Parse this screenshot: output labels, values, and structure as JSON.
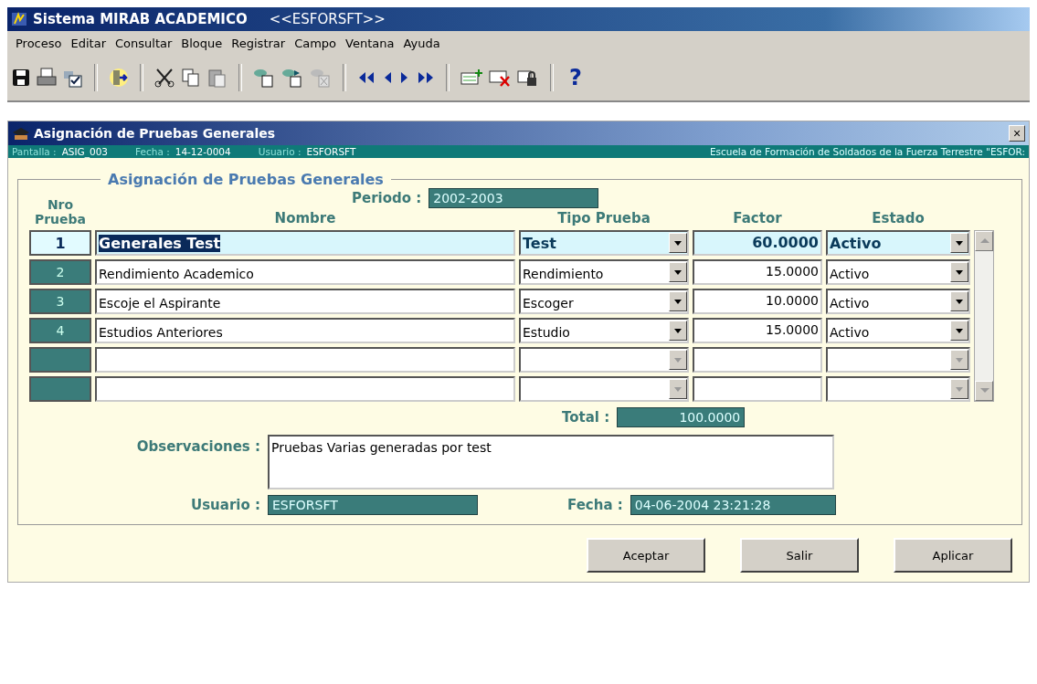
{
  "app_window": {
    "title": "Sistema MIRAB ACADEMICO",
    "subtitle": "<<ESFORSFT>>"
  },
  "menu": [
    "Proceso",
    "Editar",
    "Consultar",
    "Bloque",
    "Registrar",
    "Campo",
    "Ventana",
    "Ayuda"
  ],
  "toolbar": {
    "help": "?"
  },
  "form_window": {
    "title": "Asignación de Pruebas Generales",
    "close": "×"
  },
  "info_bar": {
    "pantalla_label": "Pantalla :",
    "pantalla": "ASIG_003",
    "fecha_label": "Fecha :",
    "fecha": "14-12-0004",
    "usuario_label": "Usuario :",
    "usuario": "ESFORSFT",
    "school": "Escuela de Formación de Soldados de la Fuerza Terrestre \"ESFOR:"
  },
  "group": {
    "title": "Asignación de Pruebas Generales"
  },
  "periodo": {
    "label": "Periodo :",
    "value": "2002-2003"
  },
  "columns": {
    "nro": [
      "Nro",
      "Prueba"
    ],
    "nombre": "Nombre",
    "tipo": "Tipo Prueba",
    "factor": "Factor",
    "estado": "Estado"
  },
  "rows": [
    {
      "nro": "1",
      "nombre": "Generales Test",
      "tipo": "Test",
      "factor": "60.0000",
      "estado": "Activo",
      "selected": true
    },
    {
      "nro": "2",
      "nombre": "Rendimiento Academico",
      "tipo": "Rendimiento",
      "factor": "15.0000",
      "estado": "Activo",
      "selected": false
    },
    {
      "nro": "3",
      "nombre": "Escoje el Aspirante",
      "tipo": "Escoger",
      "factor": "10.0000",
      "estado": "Activo",
      "selected": false
    },
    {
      "nro": "4",
      "nombre": "Estudios Anteriores",
      "tipo": "Estudio",
      "factor": "15.0000",
      "estado": "Activo",
      "selected": false
    },
    {
      "selected": false
    },
    {
      "selected": false
    }
  ],
  "total": {
    "label": "Total :",
    "value": "100.0000"
  },
  "observaciones": {
    "label": "Observaciones :",
    "value": "Pruebas Varias generadas por test"
  },
  "usuario": {
    "label": "Usuario :",
    "value": "ESFORSFT"
  },
  "fecha": {
    "label": "Fecha :",
    "value": "04-06-2004 23:21:28"
  },
  "buttons": [
    "Aceptar",
    "Salir",
    "Aplicar"
  ]
}
